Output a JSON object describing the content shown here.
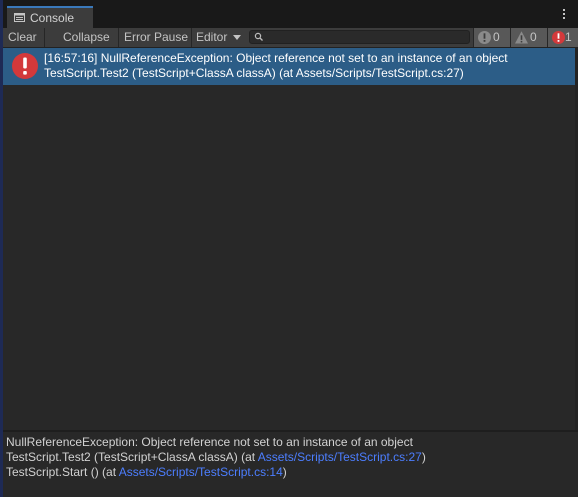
{
  "tab": {
    "icon": "console-icon",
    "label": "Console"
  },
  "menu": {
    "icon": "kebab-menu-icon"
  },
  "toolbar": {
    "clear_label": "Clear",
    "collapse_label": "Collapse",
    "error_pause_label": "Error Pause",
    "editor_label": "Editor",
    "search": {
      "placeholder": "",
      "value": ""
    },
    "counts": {
      "info": "0",
      "warning": "0",
      "error": "1"
    }
  },
  "colors": {
    "selection": "#2c5d87",
    "error": "#d3393b",
    "link": "#4c7eff",
    "tab_accent": "#3a79bb"
  },
  "log_entries": [
    {
      "icon": "error-icon",
      "line1": "[16:57:16] NullReferenceException: Object reference not set to an instance of an object",
      "line2": "TestScript.Test2 (TestScript+ClassA classA) (at Assets/Scripts/TestScript.cs:27)"
    }
  ],
  "detail": {
    "line1": "NullReferenceException: Object reference not set to an instance of an object",
    "line2_prefix": "TestScript.Test2 (TestScript+ClassA classA) (at ",
    "line2_link": "Assets/Scripts/TestScript.cs:27",
    "line2_suffix": ")",
    "line3_prefix": "TestScript.Start () (at ",
    "line3_link": "Assets/Scripts/TestScript.cs:14",
    "line3_suffix": ")"
  }
}
